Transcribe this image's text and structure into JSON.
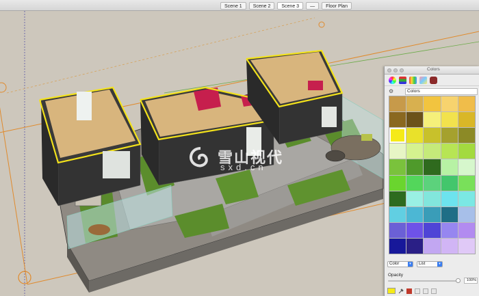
{
  "scene_tabs": [
    "Scene 1",
    "Scene 2",
    "Scene 3",
    "—",
    "Floor Plan"
  ],
  "watermark": {
    "brand": "雪山视代",
    "domain": "sxd.cn"
  },
  "colors_panel": {
    "title": "Colors",
    "palette_name": "Colors",
    "view_mode": "Color",
    "list_mode": "List",
    "opacity_label": "Opacity",
    "opacity_value": "100%",
    "opacity_level": 1.0,
    "selected_color": "#f5ea18",
    "mode_icons": [
      "color-wheel-icon",
      "color-sliders-icon",
      "color-palettes-icon",
      "image-palettes-icon",
      "crayons-icon"
    ],
    "swatches": [
      "#c79a4a",
      "#d8b04f",
      "#f2c43f",
      "#f7d36e",
      "#f0bd4a",
      "#8a6820",
      "#6b521a",
      "#f5f07a",
      "#f2e24d",
      "#d9b727",
      "#f5ea18",
      "#e9e12a",
      "#c8c12b",
      "#a5a12e",
      "#8c8a26",
      "#e7f5c5",
      "#d5f28f",
      "#c5ea7a",
      "#b7e554",
      "#a3da3f",
      "#7ac23c",
      "#4f9a2b",
      "#2f6a1e",
      "#b7f2a4",
      "#d6f7cc",
      "#6ad52e",
      "#53d65b",
      "#5cd27c",
      "#43c66c",
      "#79e05a",
      "#2d6b1f",
      "#9af0e4",
      "#82e6dc",
      "#6de3ee",
      "#7be8e4",
      "#61cfe2",
      "#4cb7d4",
      "#3a9db8",
      "#1f6e86",
      "#a7bfe9",
      "#6b60d6",
      "#6e52e8",
      "#4f44d6",
      "#9686f0",
      "#b28bf0",
      "#17189a",
      "#2a1f86",
      "#c2a7f2",
      "#d1b5f5",
      "#e0c9f7"
    ]
  }
}
